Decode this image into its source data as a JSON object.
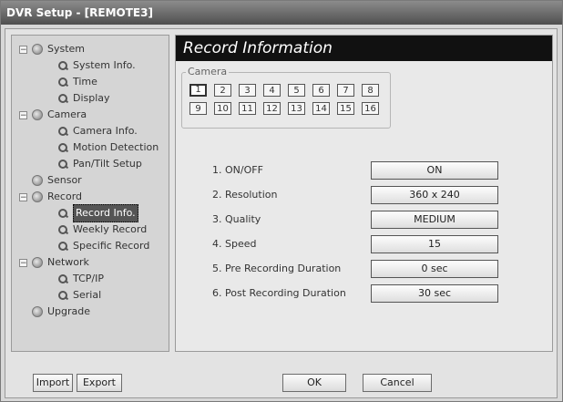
{
  "window": {
    "title": "DVR Setup - [REMOTE3]"
  },
  "sidebar": {
    "items": [
      {
        "label": "System",
        "level": 0,
        "toggle": "−"
      },
      {
        "label": "System Info.",
        "level": 1
      },
      {
        "label": "Time",
        "level": 1
      },
      {
        "label": "Display",
        "level": 1
      },
      {
        "label": "Camera",
        "level": 0,
        "toggle": "−"
      },
      {
        "label": "Camera Info.",
        "level": 1
      },
      {
        "label": "Motion Detection",
        "level": 1
      },
      {
        "label": "Pan/Tilt Setup",
        "level": 1
      },
      {
        "label": "Sensor",
        "level": 0
      },
      {
        "label": "Record",
        "level": 0,
        "toggle": "−"
      },
      {
        "label": "Record Info.",
        "level": 1,
        "selected": true
      },
      {
        "label": "Weekly Record",
        "level": 1
      },
      {
        "label": "Specific Record",
        "level": 1
      },
      {
        "label": "Network",
        "level": 0,
        "toggle": "−"
      },
      {
        "label": "TCP/IP",
        "level": 1
      },
      {
        "label": "Serial",
        "level": 1
      },
      {
        "label": "Upgrade",
        "level": 0
      }
    ]
  },
  "main": {
    "title": "Record Information",
    "camera_group": {
      "label": "Camera",
      "buttons": [
        "1",
        "2",
        "3",
        "4",
        "5",
        "6",
        "7",
        "8",
        "9",
        "10",
        "11",
        "12",
        "13",
        "14",
        "15",
        "16"
      ],
      "selected": "1"
    },
    "fields": [
      {
        "label": "1. ON/OFF",
        "value": "ON"
      },
      {
        "label": "2. Resolution",
        "value": "360 x 240"
      },
      {
        "label": "3. Quality",
        "value": "MEDIUM"
      },
      {
        "label": "4. Speed",
        "value": "15"
      },
      {
        "label": "5. Pre Recording Duration",
        "value": "0 sec"
      },
      {
        "label": "6. Post Recording Duration",
        "value": "30 sec"
      }
    ]
  },
  "footer": {
    "import_label": "Import",
    "export_label": "Export",
    "ok_label": "OK",
    "cancel_label": "Cancel"
  }
}
